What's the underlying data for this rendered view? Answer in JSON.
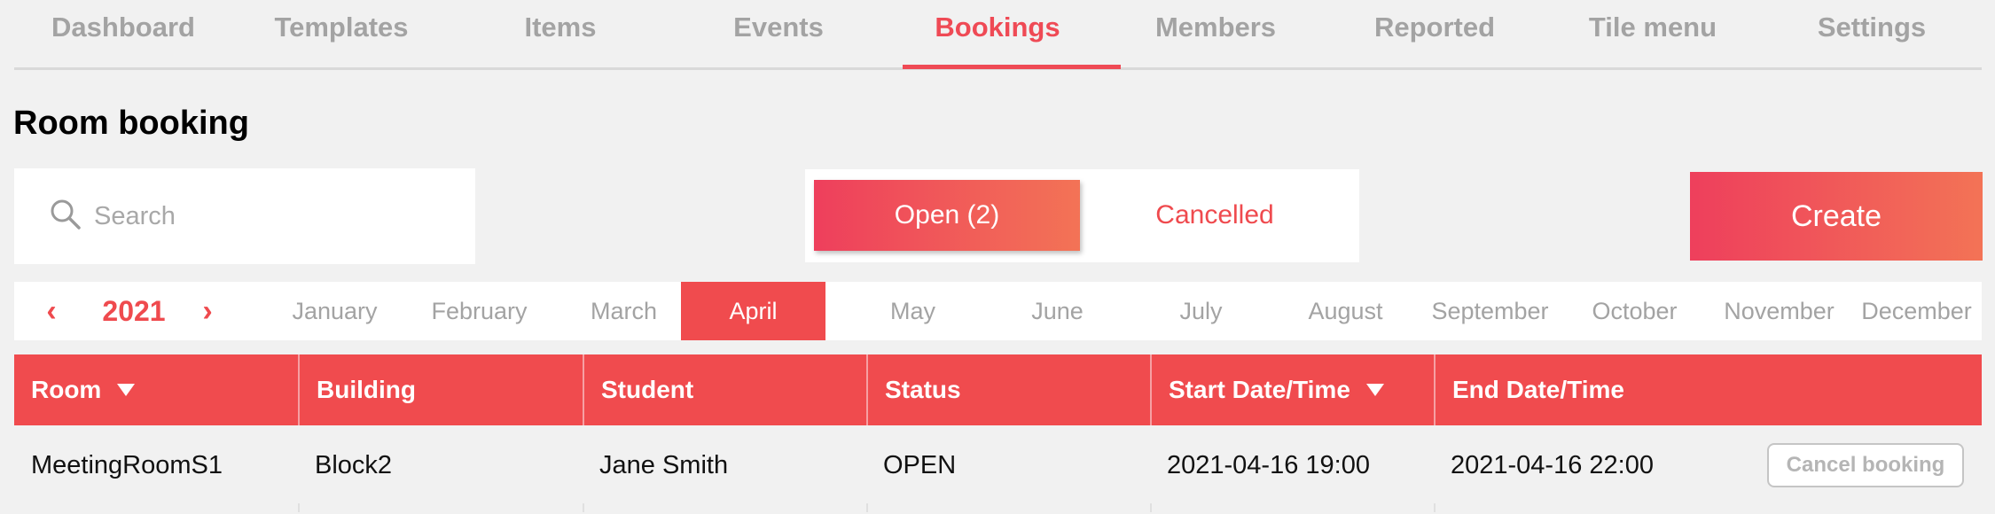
{
  "nav": {
    "items": [
      {
        "label": "Dashboard"
      },
      {
        "label": "Templates"
      },
      {
        "label": "Items"
      },
      {
        "label": "Events"
      },
      {
        "label": "Bookings"
      },
      {
        "label": "Members"
      },
      {
        "label": "Reported"
      },
      {
        "label": "Tile menu"
      },
      {
        "label": "Settings"
      }
    ],
    "active": "Bookings"
  },
  "page_title": "Room booking",
  "search": {
    "placeholder": "Search",
    "value": ""
  },
  "toggle": {
    "open_label": "Open (2)",
    "cancelled_label": "Cancelled",
    "active": "Open (2)"
  },
  "create_label": "Create",
  "calendar": {
    "prev_icon": "‹",
    "next_icon": "›",
    "year": "2021",
    "months": [
      "January",
      "February",
      "March",
      "April",
      "May",
      "June",
      "July",
      "August",
      "September",
      "October",
      "November",
      "December"
    ],
    "active_month": "April"
  },
  "table": {
    "headers": [
      "Room",
      "Building",
      "Student",
      "Status",
      "Start Date/Time",
      "End Date/Time"
    ],
    "rows": [
      {
        "room": "MeetingRoomS1",
        "building": "Block2",
        "student": "Jane Smith",
        "status": "OPEN",
        "start": "2021-04-16 19:00",
        "end": "2021-04-16 22:00",
        "action": "Cancel booking"
      }
    ]
  },
  "colors": {
    "accent": "#f04b4e",
    "gradient_start": "#ee3f5c",
    "gradient_end": "#f37356",
    "muted": "#a3a3a3",
    "background": "#f1f1f1"
  }
}
